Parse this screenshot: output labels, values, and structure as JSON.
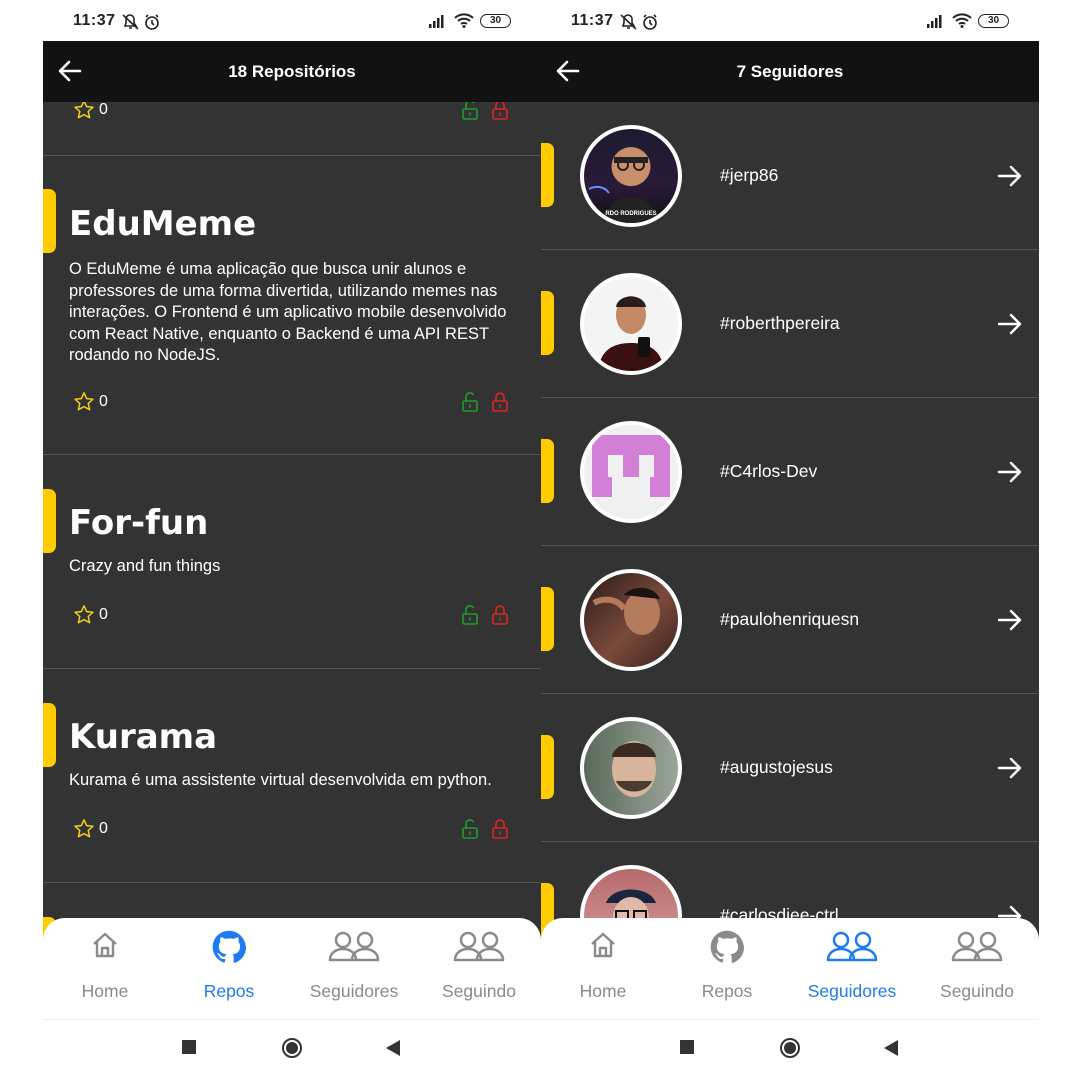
{
  "status_bar": {
    "time": "11:37",
    "battery": "30"
  },
  "repos_screen": {
    "title": "18 Repositórios",
    "partial_top_stars": "0",
    "repos": [
      {
        "name": "EduMeme",
        "description": "O EduMeme é uma aplicação que busca unir alunos e professores de uma forma divertida,  utilizando memes nas interações. O Frontend é um aplicativo mobile desenvolvido com React Native, enquanto o Backend é uma API REST  rodando no NodeJS.",
        "stars": "0"
      },
      {
        "name": "For-fun",
        "description": "Crazy and fun things",
        "stars": "0"
      },
      {
        "name": "Kurama",
        "description": "Kurama é uma assistente virtual desenvolvida em python.",
        "stars": "0"
      }
    ]
  },
  "followers_screen": {
    "title": "7 Seguidores",
    "followers": [
      {
        "login": "#jerp86"
      },
      {
        "login": "#roberthpereira"
      },
      {
        "login": "#C4rlos-Dev"
      },
      {
        "login": "#paulohenriquesn"
      },
      {
        "login": "#augustojesus"
      },
      {
        "login": "#carlosdiee-ctrl"
      }
    ],
    "avatar_caption": "RDO RODRIGUES"
  },
  "tabs": [
    {
      "label": "Home",
      "icon": "home-icon"
    },
    {
      "label": "Repos",
      "icon": "github-icon"
    },
    {
      "label": "Seguidores",
      "icon": "users-icon"
    },
    {
      "label": "Seguindo",
      "icon": "users-icon"
    }
  ],
  "active_tab": {
    "left": "Repos",
    "right": "Seguidores"
  },
  "colors": {
    "accent": "#ffcc00",
    "active_tab": "#1e7bf2",
    "card_bg": "#333333",
    "header_bg": "#121212",
    "unlock_icon": "#1f9d2b",
    "lock_icon": "#e02424",
    "star": "#f2d21c"
  }
}
